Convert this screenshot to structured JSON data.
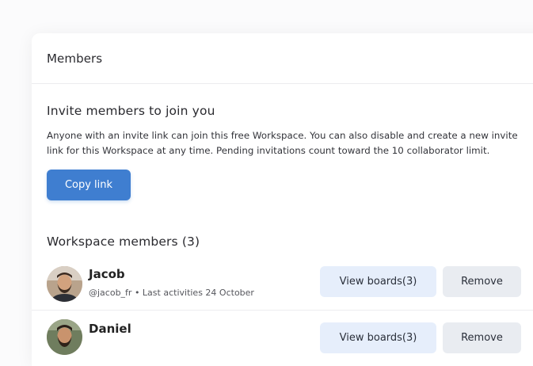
{
  "panel": {
    "title": "Members"
  },
  "invite": {
    "title": "Invite members to join you",
    "description": "Anyone with an invite link can join this free Workspace. You can also disable and create a new invite link for this Workspace at any time. Pending invitations count toward the 10 collaborator limit.",
    "copy_label": "Copy link",
    "accent_color": "#3f7ed0"
  },
  "members": {
    "title": "Workspace members (3)",
    "list": [
      {
        "name": "Jacob",
        "meta": "@jacob_fr • Last activities 24 October",
        "view_label": "View boards(3)",
        "remove_label": "Remove",
        "avatar_icon": "avatar-photo"
      },
      {
        "name": "Daniel",
        "meta": "",
        "view_label": "View boards(3)",
        "remove_label": "Remove",
        "avatar_icon": "avatar-photo"
      }
    ]
  }
}
